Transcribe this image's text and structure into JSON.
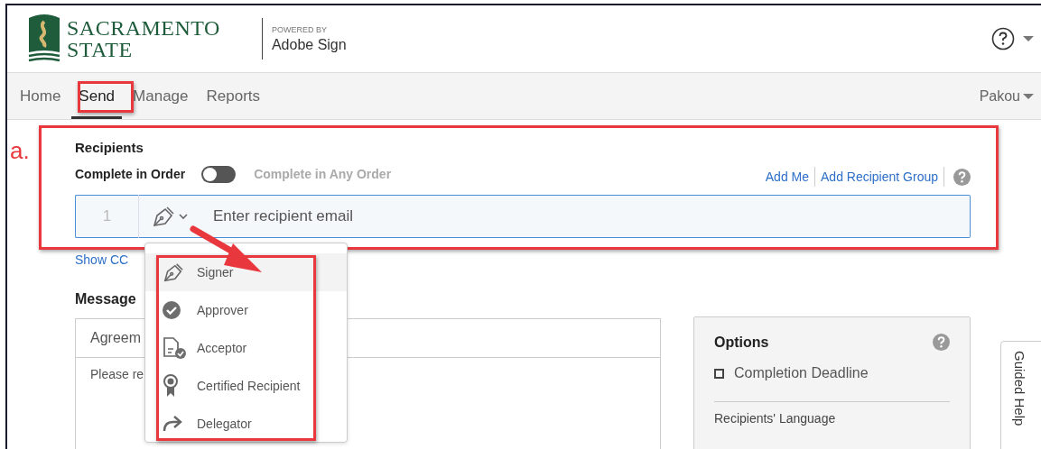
{
  "header": {
    "logo_line1": "SACRAMENTO",
    "logo_line2": "STATE",
    "powered_by": "POWERED BY",
    "product": "Adobe Sign"
  },
  "nav": {
    "tabs": [
      {
        "label": "Home",
        "selected": false
      },
      {
        "label": "Send",
        "selected": true
      },
      {
        "label": "Manage",
        "selected": false
      },
      {
        "label": "Reports",
        "selected": false
      }
    ],
    "user": "Pakou"
  },
  "annotation": {
    "label": "a."
  },
  "recipients": {
    "title": "Recipients",
    "order_label": "Complete in Order",
    "any_order": false,
    "any_order_label": "Complete in Any Order",
    "links": [
      "Add Me",
      "Add Recipient Group"
    ],
    "rows": [
      {
        "number": "1",
        "placeholder": "Enter recipient email"
      }
    ],
    "show_cc": "Show CC"
  },
  "role_menu": {
    "items": [
      {
        "kind": "signer",
        "label": "Signer",
        "selected": true
      },
      {
        "kind": "approver",
        "label": "Approver",
        "selected": false
      },
      {
        "kind": "acceptor",
        "label": "Acceptor",
        "selected": false
      },
      {
        "kind": "certified",
        "label": "Certified Recipient",
        "selected": false
      },
      {
        "kind": "delegator",
        "label": "Delegator",
        "selected": false
      }
    ]
  },
  "message": {
    "title": "Message",
    "name_field": "Agreem",
    "body": "Please re"
  },
  "options": {
    "title": "Options",
    "items": [
      {
        "label": "Completion Deadline",
        "checked": false
      }
    ],
    "section": "Recipients' Language"
  },
  "guided_help": "Guided Help"
}
